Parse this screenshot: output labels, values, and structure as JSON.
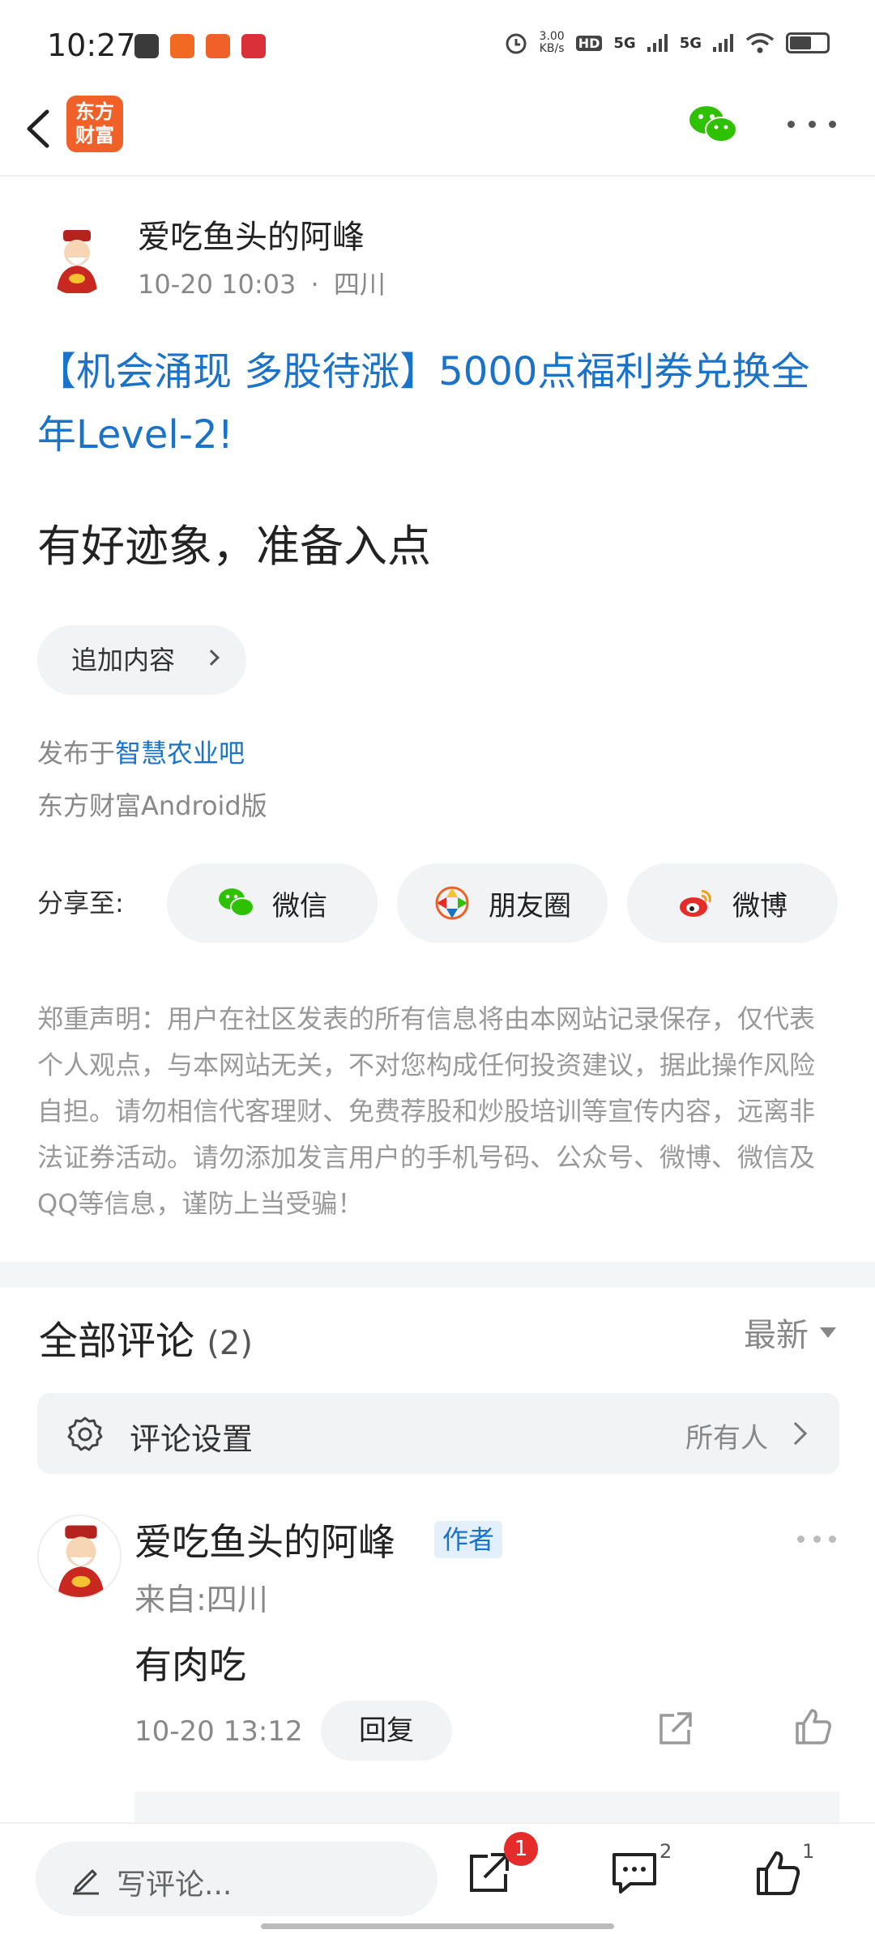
{
  "status_bar": {
    "time": "10:27",
    "net_speed_top": "3.00",
    "net_speed_bottom": "KB/s",
    "hd": "HD",
    "sig1": "5G",
    "sig2": "5G"
  },
  "nav": {
    "logo_line1": "东方",
    "logo_line2": "财富"
  },
  "post": {
    "author_name": "爱吃鱼头的阿峰",
    "time": "10-20 10:03",
    "dot": "·",
    "location": "四川",
    "title": "【机会涌现 多股待涨】5000点福利券兑换全年Level-2!",
    "body": "有好迹象，准备入点",
    "append_label": "追加内容",
    "published_prefix": "发布于",
    "published_bar": "智慧农业吧",
    "client": "东方财富Android版",
    "share_label": "分享至:",
    "share_wechat": "微信",
    "share_moments": "朋友圈",
    "share_weibo": "微博",
    "disclaimer": "郑重声明：用户在社区发表的所有信息将由本网站记录保存，仅代表个人观点，与本网站无关，不对您构成任何投资建议，据此操作风险自担。请勿相信代客理财、免费荐股和炒股培训等宣传内容，远离非法证券活动。请勿添加发言用户的手机号码、公众号、微博、微信及QQ等信息，谨防上当受骗！"
  },
  "comments": {
    "title": "全部评论",
    "count": "(2)",
    "sort": "最新",
    "settings_label": "评论设置",
    "settings_value": "所有人",
    "items": [
      {
        "name": "爱吃鱼头的阿峰",
        "badge": "作者",
        "from": "来自:四川",
        "text": "有肉吃",
        "time": "10-20 13:12",
        "reply": "回复"
      }
    ]
  },
  "bottom": {
    "write_placeholder": "写评论...",
    "share_badge": "1",
    "comment_count": "2",
    "like_count": "1"
  },
  "colors": {
    "link_blue": "#1a73c8",
    "brand_orange": "#f0612a",
    "badge_red": "#e62b2b"
  }
}
